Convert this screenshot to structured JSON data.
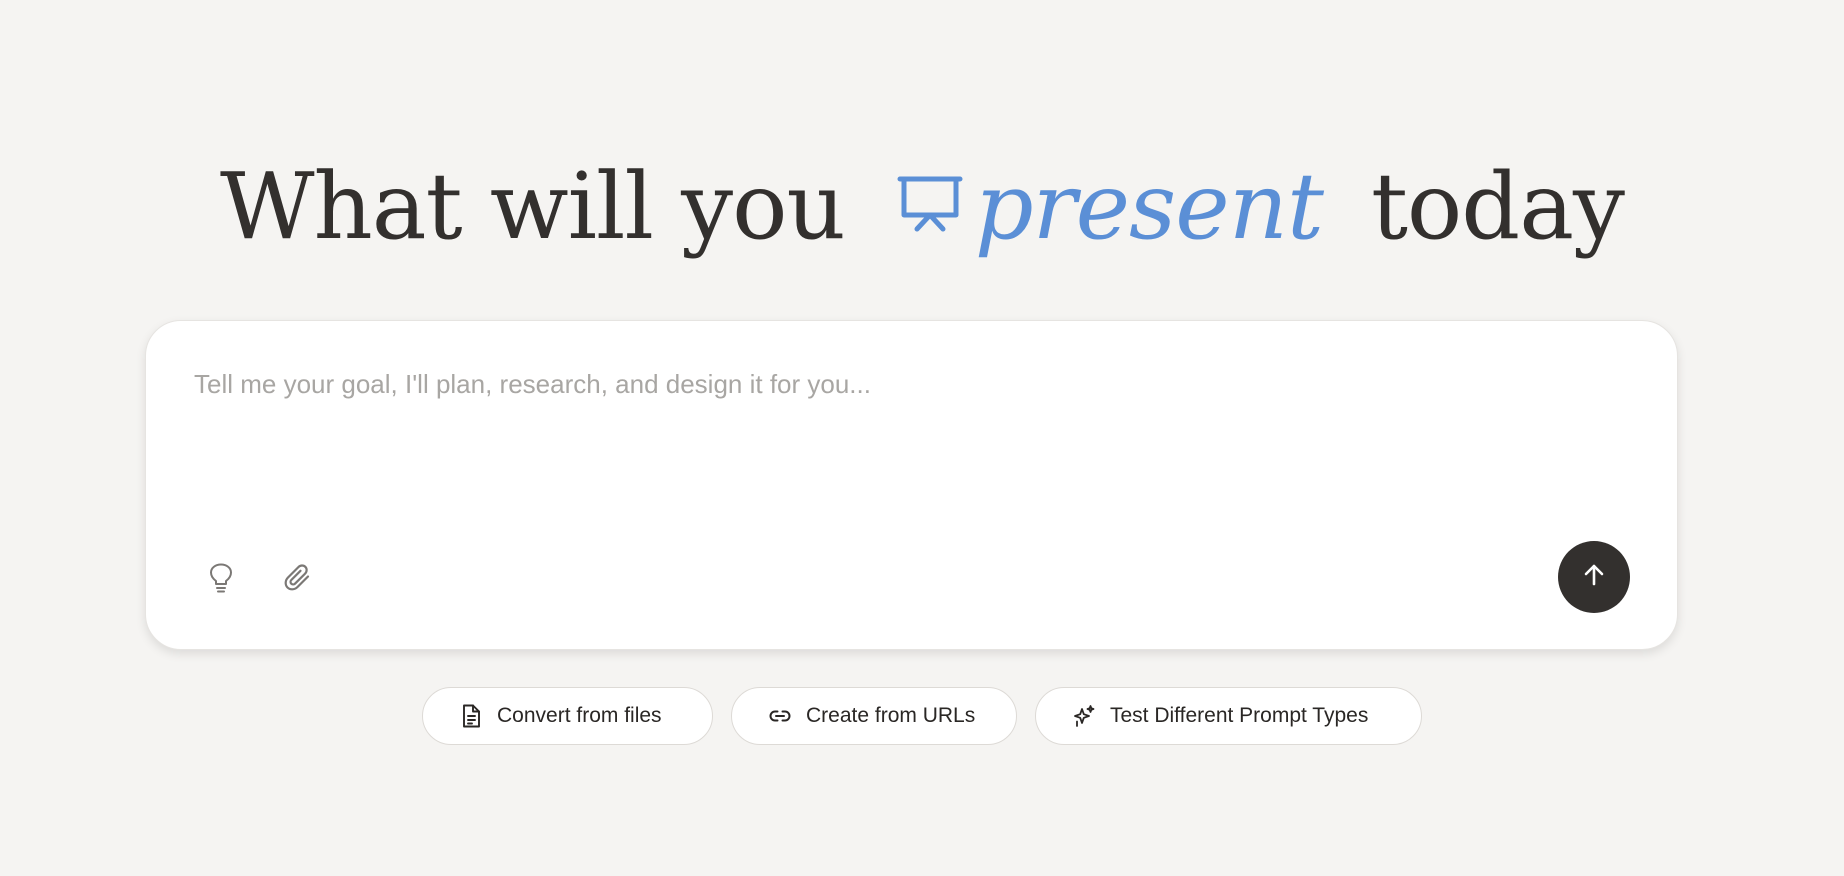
{
  "headline": {
    "before": "What will you",
    "accent": "present",
    "after": "today",
    "accent_color": "#5b8fd6",
    "accent_icon": "presentation-board-icon"
  },
  "composer": {
    "placeholder": "Tell me your goal, I'll plan, research, and design it for you...",
    "value": "",
    "tools": [
      {
        "icon": "lightbulb-icon"
      },
      {
        "icon": "paperclip-icon"
      }
    ],
    "send_icon": "arrow-up-icon",
    "send_color": "#33302e"
  },
  "chips": [
    {
      "label": "Convert from files",
      "icon": "document-icon"
    },
    {
      "label": "Create from URLs",
      "icon": "link-icon"
    },
    {
      "label": "Test Different Prompt Types",
      "icon": "sparkles-icon"
    }
  ]
}
